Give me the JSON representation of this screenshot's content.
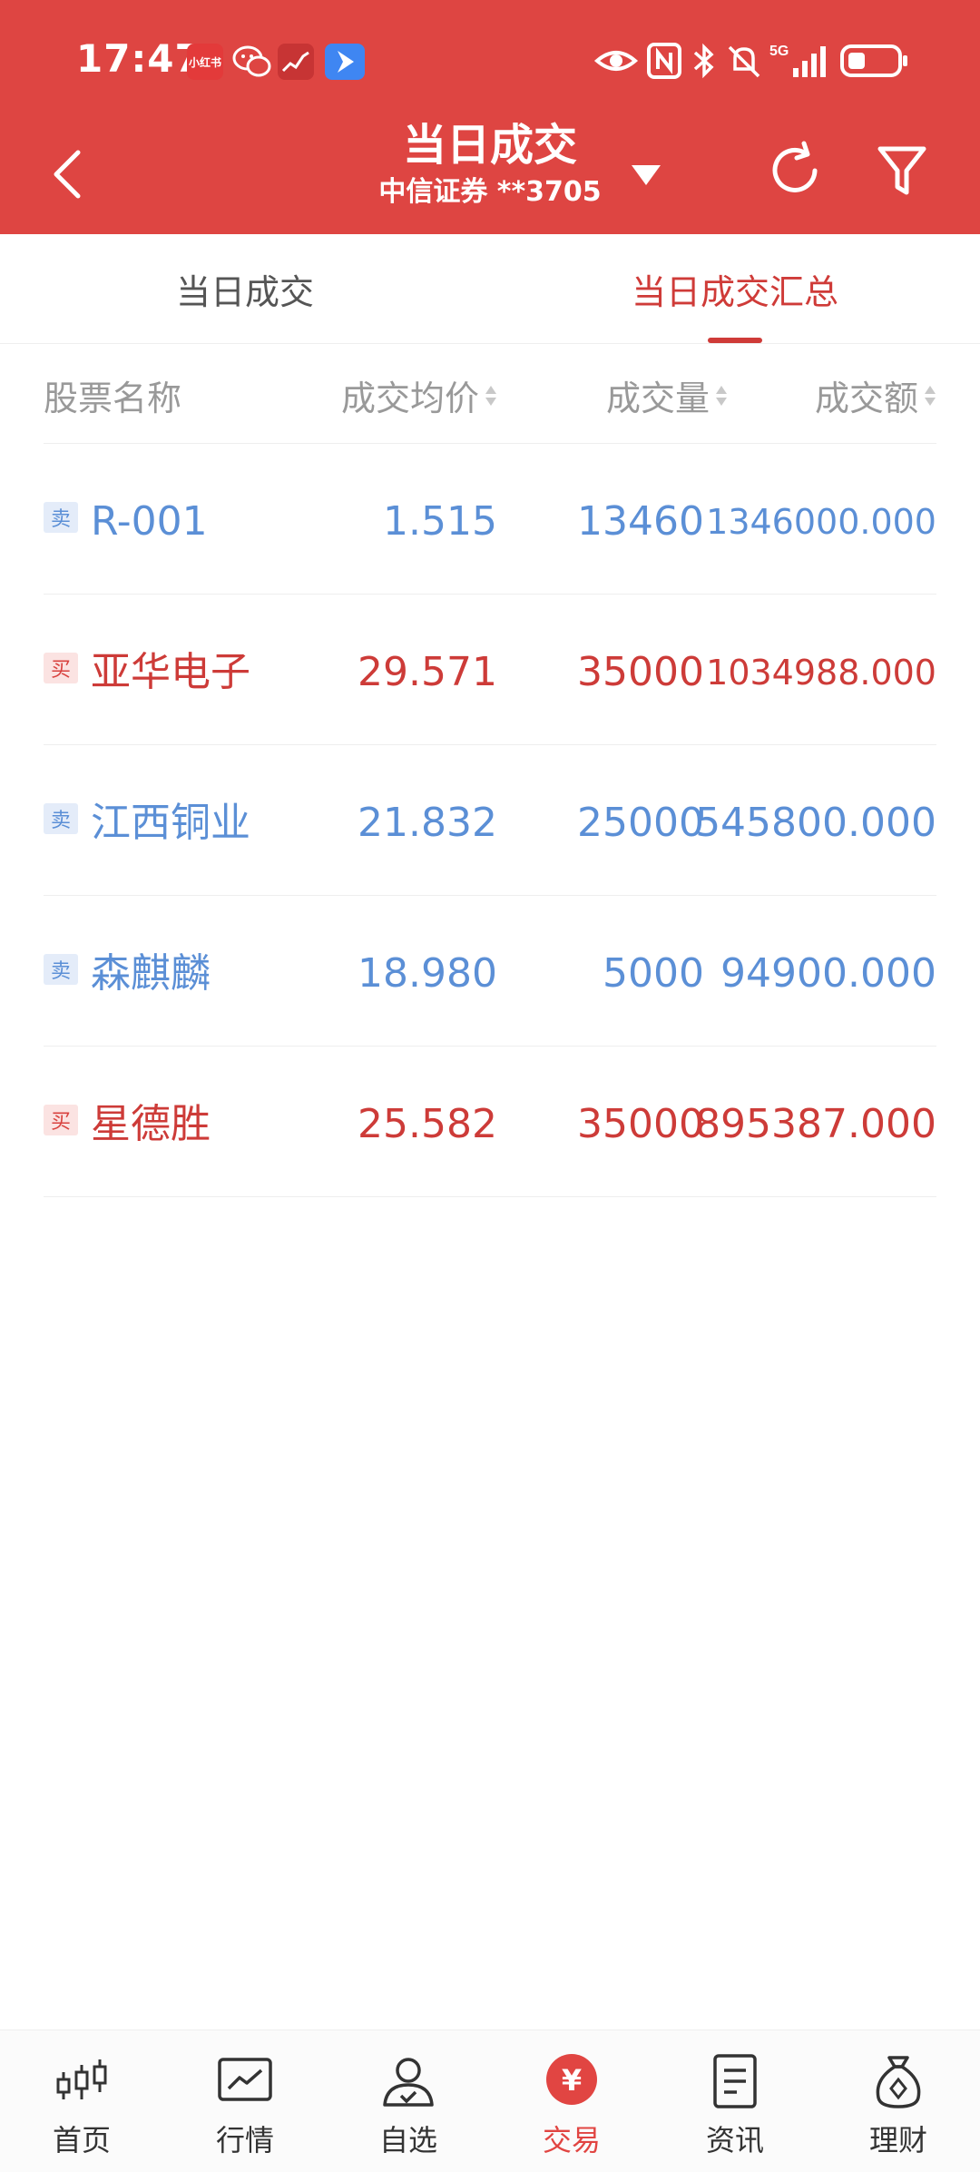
{
  "status_bar": {
    "time": "17:47",
    "app_xhs_label": "小红书",
    "network_label": "5G"
  },
  "header": {
    "title": "当日成交",
    "broker": "中信证券",
    "account": "**3705"
  },
  "tabs": [
    {
      "label": "当日成交"
    },
    {
      "label": "当日成交汇总",
      "active": true
    }
  ],
  "columns": {
    "name": "股票名称",
    "avg_price": "成交均价",
    "volume": "成交量",
    "amount": "成交额"
  },
  "rows": [
    {
      "side": "卖",
      "name": "R-001",
      "avg_price": "1.515",
      "volume": "13460",
      "amount": "1346000.000"
    },
    {
      "side": "买",
      "name": "亚华电子",
      "avg_price": "29.571",
      "volume": "35000",
      "amount": "1034988.000"
    },
    {
      "side": "卖",
      "name": "江西铜业",
      "avg_price": "21.832",
      "volume": "25000",
      "amount": "545800.000"
    },
    {
      "side": "卖",
      "name": "森麒麟",
      "avg_price": "18.980",
      "volume": "5000",
      "amount": "94900.000"
    },
    {
      "side": "买",
      "name": "星德胜",
      "avg_price": "25.582",
      "volume": "35000",
      "amount": "895387.000"
    }
  ],
  "bottom_nav": [
    {
      "label": "首页",
      "icon": "candlestick-icon"
    },
    {
      "label": "行情",
      "icon": "chart-line-icon"
    },
    {
      "label": "自选",
      "icon": "person-check-icon"
    },
    {
      "label": "交易",
      "icon": "yuan-icon",
      "active": true,
      "icon_glyph": "¥"
    },
    {
      "label": "资讯",
      "icon": "document-icon"
    },
    {
      "label": "理财",
      "icon": "money-bag-icon"
    }
  ],
  "colors": {
    "header_bg": "#de4542",
    "accent_red": "#cd3b38",
    "sell_blue": "#5b8fd6",
    "muted": "#999999"
  }
}
